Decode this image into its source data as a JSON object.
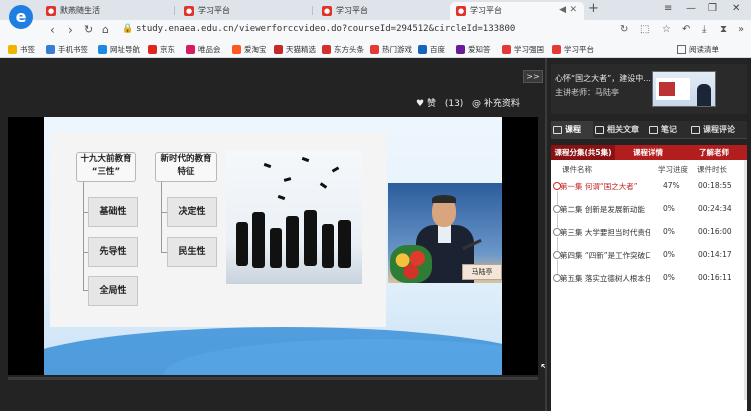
{
  "tabs": [
    {
      "label": "默燕随生活",
      "icon": "app-icon"
    },
    {
      "label": "学习平台",
      "icon": "app-icon"
    },
    {
      "label": "学习平台",
      "icon": "app-icon"
    },
    {
      "label": "学习平台",
      "icon": "app-icon"
    }
  ],
  "address": {
    "url": "study.enaea.edu.cn/viewerforccvideo.do?courseId=294512&circleId=133800"
  },
  "bookmarks": [
    {
      "label": "书签",
      "color": "#f0b400"
    },
    {
      "label": "手机书签",
      "color": "#3a7bd5"
    },
    {
      "label": "网址导航",
      "color": "#1e88e5"
    },
    {
      "label": "京东",
      "color": "#e1251b"
    },
    {
      "label": "唯品会",
      "color": "#d81b60"
    },
    {
      "label": "爱淘宝",
      "color": "#ff5722"
    },
    {
      "label": "天猫精选",
      "color": "#c62828"
    },
    {
      "label": "东方头条",
      "color": "#d32f2f"
    },
    {
      "label": "热门游戏",
      "color": "#e53935"
    },
    {
      "label": "百度",
      "color": "#1565c0"
    },
    {
      "label": "爱知答",
      "color": "#6a1b9a"
    },
    {
      "label": "学习强国",
      "color": "#e53935"
    },
    {
      "label": "学习平台",
      "color": "#e53935"
    }
  ],
  "bookmarks_right": "阅读清单",
  "player": {
    "likes_label": "赞",
    "likes_count": "(13)",
    "supplement": "补充资料",
    "toggle": ">>"
  },
  "slide": {
    "left_head_line1": "十九大前教育",
    "left_head_line2": "“三性”",
    "left_items": [
      "基础性",
      "先导性",
      "全局性"
    ],
    "right_head_line1": "新时代的教育",
    "right_head_line2": "特征",
    "right_items": [
      "决定性",
      "民生性"
    ],
    "nameplate": "马陆亭"
  },
  "course": {
    "title": "心怀“国之大者”，建设中...",
    "lecturer": "主讲老师：马陆亭"
  },
  "panel_tabs": [
    "课程",
    "相关文章",
    "笔记",
    "课程评论"
  ],
  "sub_tabs": [
    "课程分集(共5集)",
    "课程详情",
    "了解老师"
  ],
  "columns": {
    "name": "课件名称",
    "progress": "学习进度",
    "duration": "课件时长"
  },
  "lessons": [
    {
      "title": "第一集 何谓“国之大者”",
      "progress": "47%",
      "duration": "00:18:55"
    },
    {
      "title": "第二集 创新是发展新动能",
      "progress": "0%",
      "duration": "00:24:34"
    },
    {
      "title": "第三集 大学要担当时代责任",
      "progress": "0%",
      "duration": "00:16:00"
    },
    {
      "title": "第四集 “四新”是工作突破口",
      "progress": "0%",
      "duration": "00:14:17"
    },
    {
      "title": "第五集 落实立德树人根本任务",
      "progress": "0%",
      "duration": "00:16:11"
    }
  ]
}
